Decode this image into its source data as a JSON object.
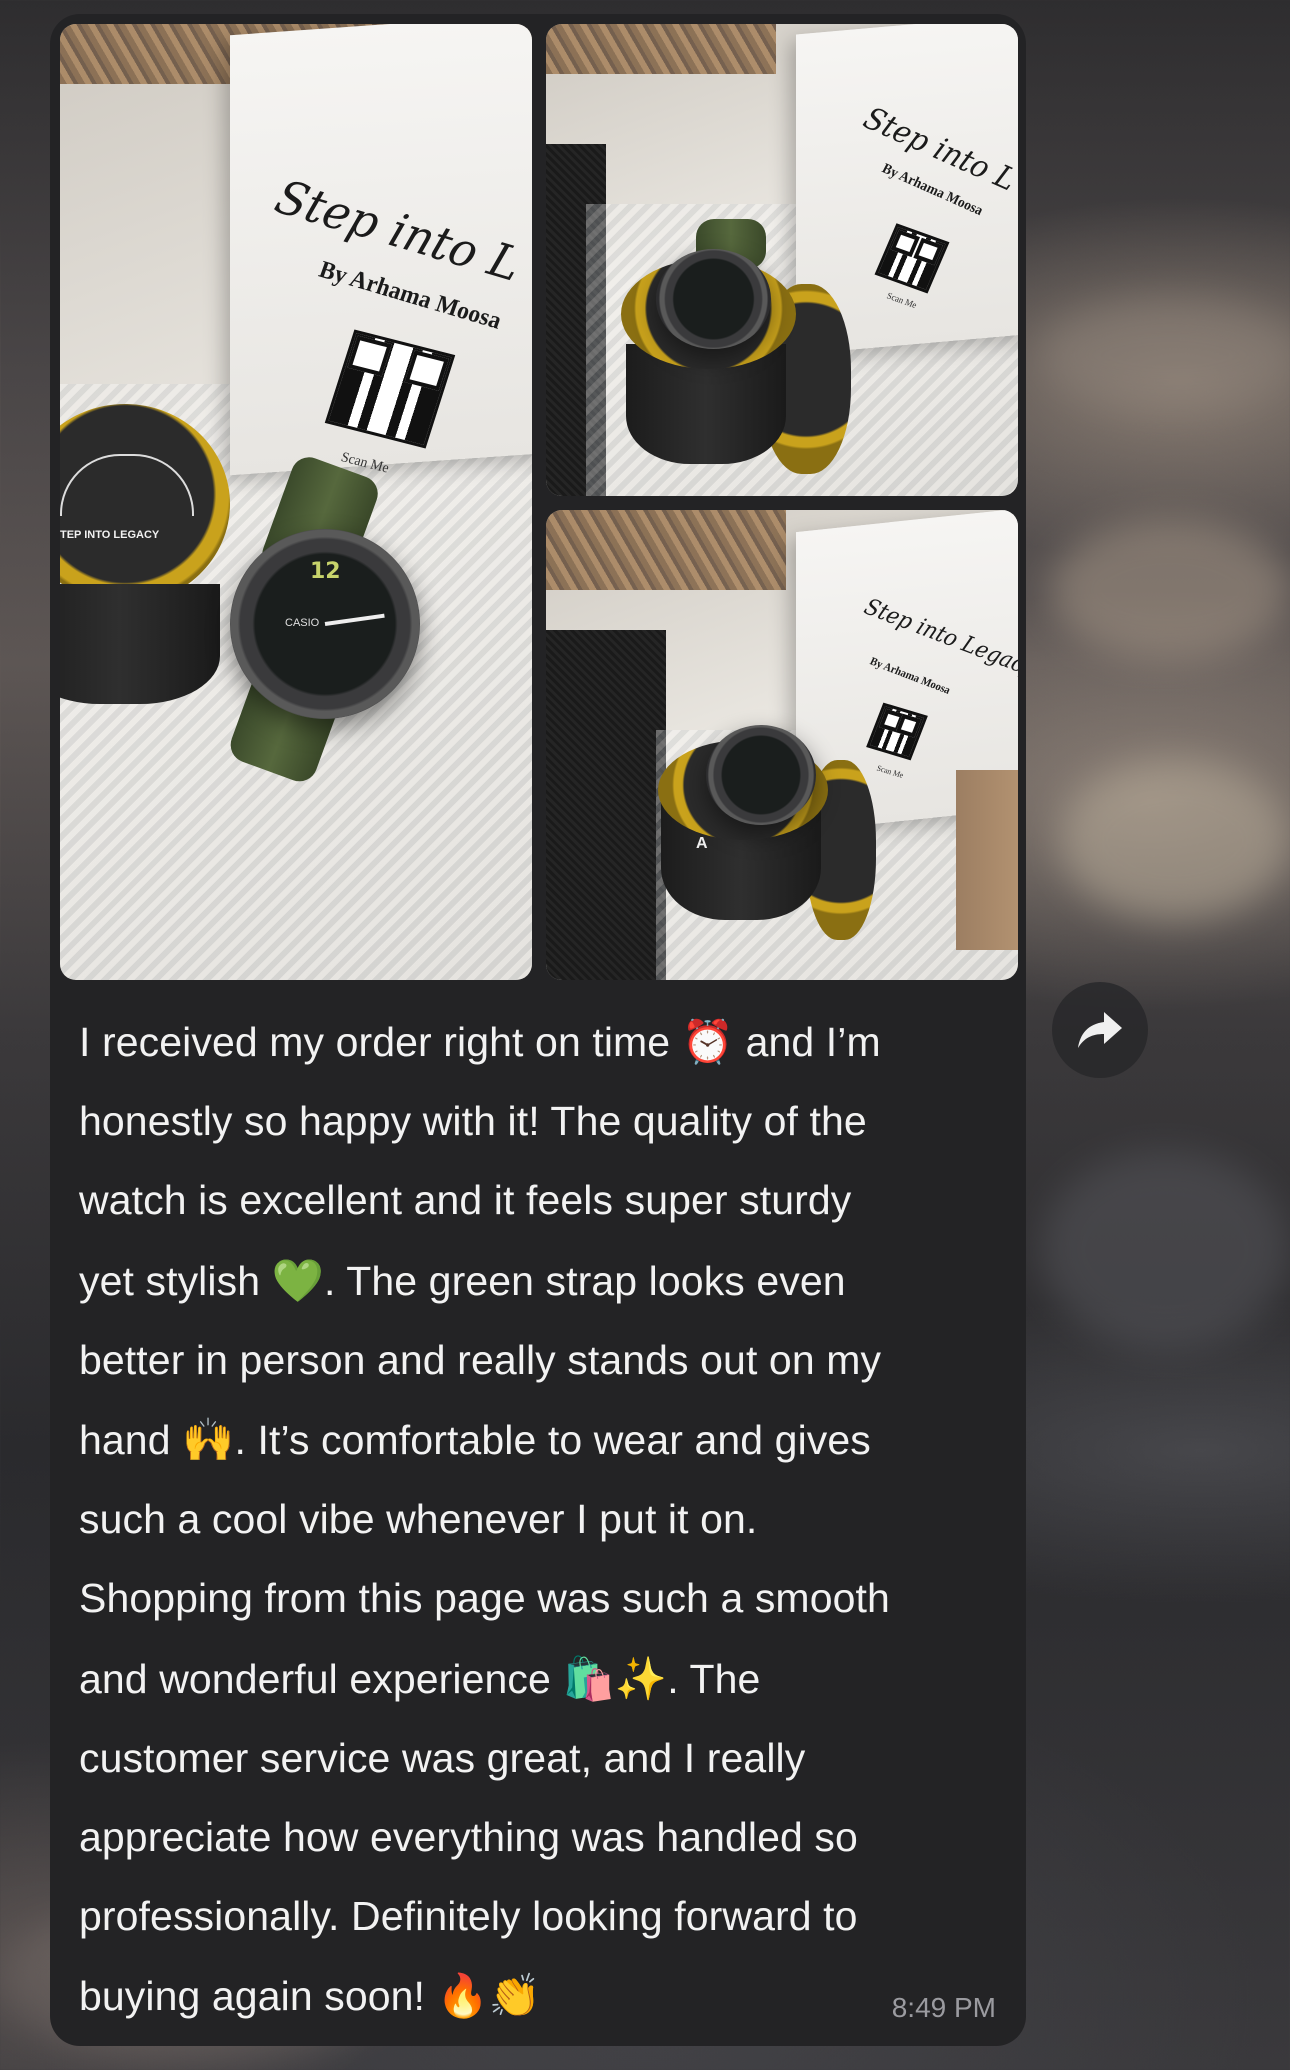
{
  "photos": {
    "main": {
      "bag_title": "Step into L",
      "bag_subtitle": "By Arhama Moosa",
      "bag_scan": "Scan Me",
      "tin_label": "TEP INTO LEGACY",
      "watch_brand": "CASIO",
      "watch_number": "12"
    },
    "top_right": {
      "bag_title": "Step into L",
      "bag_subtitle": "By Arhama Moosa",
      "bag_scan": "Scan Me"
    },
    "bottom_right": {
      "bag_title": "Step into Legacy",
      "bag_subtitle": "By Arhama Moosa",
      "bag_scan": "Scan Me",
      "tin_letter": "A"
    }
  },
  "message": {
    "lines": [
      {
        "text_before": "I received my order right on time ",
        "emoji": "⏰",
        "text_after": " and I’m"
      },
      {
        "text_before": "honestly so happy with it! The quality of the",
        "emoji": "",
        "text_after": ""
      },
      {
        "text_before": "watch is excellent and it feels super sturdy",
        "emoji": "",
        "text_after": ""
      },
      {
        "text_before": "yet stylish ",
        "emoji": "💚",
        "text_after": ". The green strap looks even"
      },
      {
        "text_before": "better in person and really stands out on my",
        "emoji": "",
        "text_after": ""
      },
      {
        "text_before": "hand ",
        "emoji": "🙌",
        "text_after": ". It’s comfortable to wear and gives"
      },
      {
        "text_before": "such a cool vibe whenever I put it on.",
        "emoji": "",
        "text_after": ""
      },
      {
        "text_before": "Shopping from this page was such a smooth",
        "emoji": "",
        "text_after": ""
      },
      {
        "text_before": "and wonderful experience ",
        "emoji": "🛍️✨",
        "text_after": ". The"
      },
      {
        "text_before": "customer service was great, and I really",
        "emoji": "",
        "text_after": ""
      },
      {
        "text_before": "appreciate how everything was handled so",
        "emoji": "",
        "text_after": ""
      },
      {
        "text_before": "professionally. Definitely looking forward to",
        "emoji": "",
        "text_after": ""
      },
      {
        "text_before": "buying again soon! ",
        "emoji": "🔥👏",
        "text_after": ""
      }
    ],
    "timestamp": "8:49 PM"
  },
  "forward": {
    "icon": "forward-arrow-icon"
  }
}
